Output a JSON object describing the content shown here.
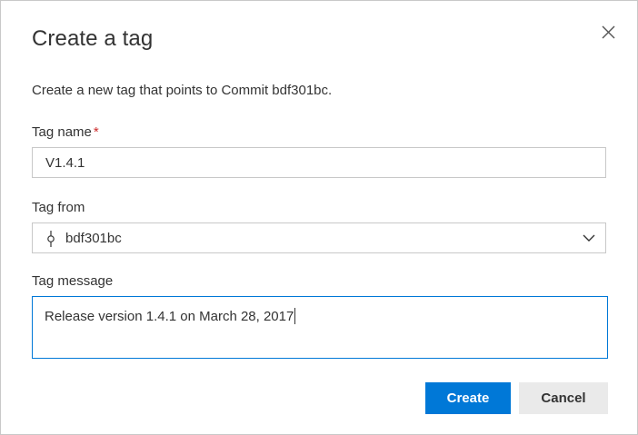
{
  "dialog": {
    "title": "Create a tag",
    "description": "Create a new tag that points to Commit bdf301bc."
  },
  "tag_name": {
    "label": "Tag name",
    "required_mark": "*",
    "value": "V1.4.1"
  },
  "tag_from": {
    "label": "Tag from",
    "icon": "commit-icon",
    "selected": "bdf301bc"
  },
  "tag_message": {
    "label": "Tag message",
    "value": "Release version 1.4.1 on March 28, 2017"
  },
  "actions": {
    "create_label": "Create",
    "cancel_label": "Cancel"
  },
  "colors": {
    "accent": "#0078d7",
    "required": "#cc2a2a",
    "secondary_button": "#eaeaea"
  }
}
